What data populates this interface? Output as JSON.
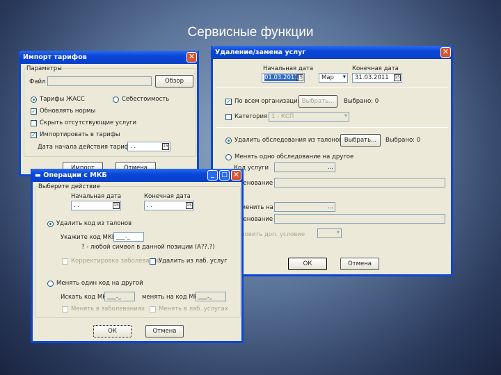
{
  "slide_title": "Сервисные функции",
  "import": {
    "title": "Импорт тарифов",
    "group": "Параметры",
    "file_label": "Файл",
    "file_value": "",
    "browse": "Обзор",
    "radio1": "Тарифы ЖАСС",
    "radio2": "Себестоимость",
    "cb1": "Обновлять нормы",
    "cb2": "Скрыть отсутствующие услуги",
    "cb3": "Импортировать в тарифы",
    "date_label": "Дата начала действия тарифов",
    "date_value": " . .",
    "ok": "Импорт",
    "cancel": "Отмена"
  },
  "delete": {
    "title": "Удаление/замена услуг",
    "start_label": "Начальная дата",
    "start_value": "01.03.2011",
    "month": "Мар",
    "end_label": "Конечная дата",
    "end_value": "31.03.2011",
    "all_orgs": "По всем организациям",
    "choose1": "Выбрать...",
    "chosen1": "Выбрано: 0",
    "category": "Категория",
    "category_value": "1 - КСП",
    "remove": "Удалить обследования из талонов",
    "choose2": "Выбрать...",
    "chosen2": "Выбрано: 0",
    "replace": "Менять одно обследование на другое",
    "code_label": "Код услуги",
    "name_label": "Наименование",
    "replace_with": "Заменить на",
    "name_label2": "Наименование",
    "extra": "Установить доп. условие",
    "browse_dots": "...",
    "ok": "ОК",
    "cancel": "Отмена"
  },
  "mkb": {
    "title": "Операции с МКБ",
    "group": "Выберите действие",
    "start_label": "Начальная дата",
    "end_label": "Конечная дата",
    "start_value": " . .",
    "end_value": " . .",
    "remove": "Удалить код из талонов",
    "code_label": "Укажите код МКБ",
    "code_value": "___._",
    "hint": "? - любой символ в данной позиции (А??.?)",
    "cb1": "Корректировка заболеваний",
    "cb2": "Удалить из лаб. услуг",
    "replace": "Менять один код на другой",
    "find_label": "Искать код МКБ",
    "find_value": "___._",
    "to_label": "менять на код МКБ",
    "to_value": "___._",
    "cb3": "Менять в заболеваниях",
    "cb4": "Менять в лаб. услугах",
    "ok": "ОК",
    "cancel": "Отмена"
  }
}
